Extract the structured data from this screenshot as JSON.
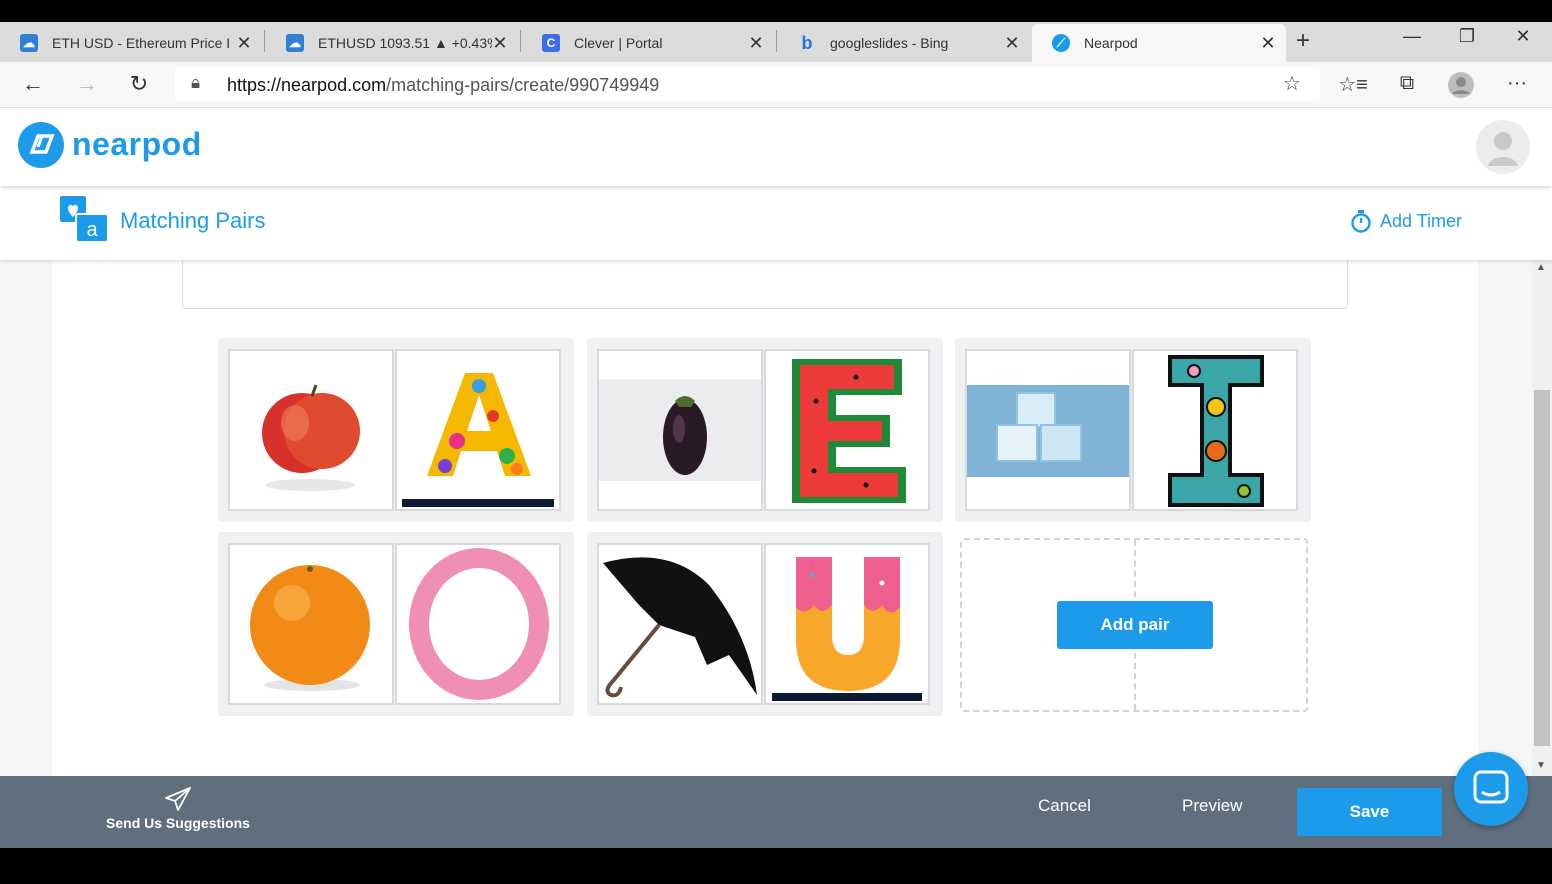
{
  "browser": {
    "tabs": [
      {
        "title": "ETH USD - Ethereum Price I",
        "icon": "cloud-icon",
        "color": "#2f7fd6"
      },
      {
        "title": "ETHUSD 1093.51 ▲ +0.43%",
        "icon": "cloud-icon",
        "color": "#2f7fd6"
      },
      {
        "title": "Clever | Portal",
        "icon": "clever-icon",
        "color": "#3b6ee8"
      },
      {
        "title": "googleslides - Bing",
        "icon": "bing-icon",
        "color": "#1a7ae0"
      },
      {
        "title": "Nearpod",
        "icon": "nearpod-icon",
        "color": "#1c9bea"
      }
    ],
    "url_host": "https://nearpod.com",
    "url_path": "/matching-pairs/create/990749949"
  },
  "app": {
    "logo_text": "nearpod",
    "section_title": "Matching Pairs",
    "add_timer_label": "Add Timer",
    "accent": "#1c9bea"
  },
  "pairs": [
    {
      "left": "apple-image",
      "right": "letter-A-image",
      "letter": "A"
    },
    {
      "left": "eggplant-image",
      "right": "letter-E-image",
      "letter": "E"
    },
    {
      "left": "ice-cubes-image",
      "right": "letter-I-image",
      "letter": "I"
    },
    {
      "left": "orange-image",
      "right": "letter-O-image",
      "letter": "O"
    },
    {
      "left": "umbrella-image",
      "right": "letter-U-image",
      "letter": "U"
    }
  ],
  "add_pair_label": "Add pair",
  "footer": {
    "suggestions_label": "Send Us Suggestions",
    "cancel_label": "Cancel",
    "preview_label": "Preview",
    "save_label": "Save"
  }
}
